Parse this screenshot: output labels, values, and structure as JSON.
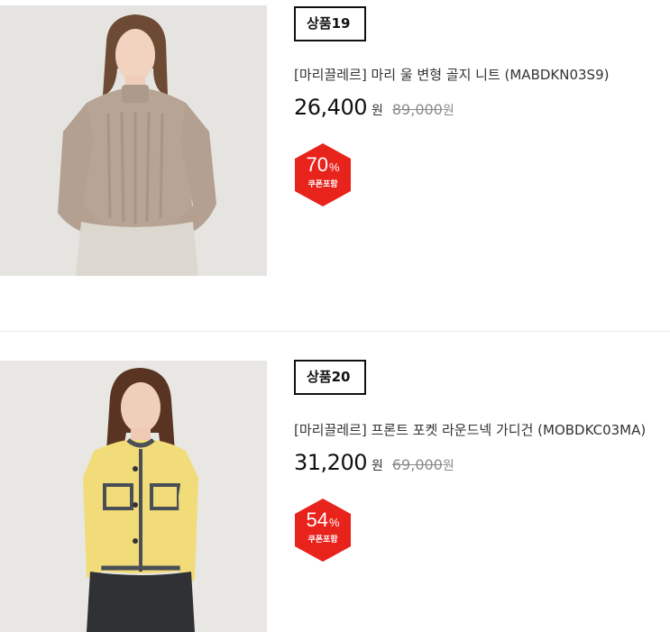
{
  "products": [
    {
      "tag": "상품19",
      "name": "[마리끌레르] 마리 울 변형 골지 니트 (MABDKN03S9)",
      "sale_price": "26,400",
      "currency": "원",
      "original_price": "89,000",
      "original_currency": "원",
      "discount": "70",
      "percent_sign": "%",
      "coupon_label": "쿠폰포함",
      "image": "model-beige-turtleneck-knit"
    },
    {
      "tag": "상품20",
      "name": "[마리끌레르] 프론트 포켓 라운드넥 가디건 (MOBDKC03MA)",
      "sale_price": "31,200",
      "currency": "원",
      "original_price": "69,000",
      "original_currency": "원",
      "discount": "54",
      "percent_sign": "%",
      "coupon_label": "쿠폰포함",
      "image": "model-yellow-cardigan"
    }
  ],
  "colors": {
    "badge_red": "#e8231c",
    "text_dark": "#111111",
    "strike_gray": "#8a8a8a"
  }
}
